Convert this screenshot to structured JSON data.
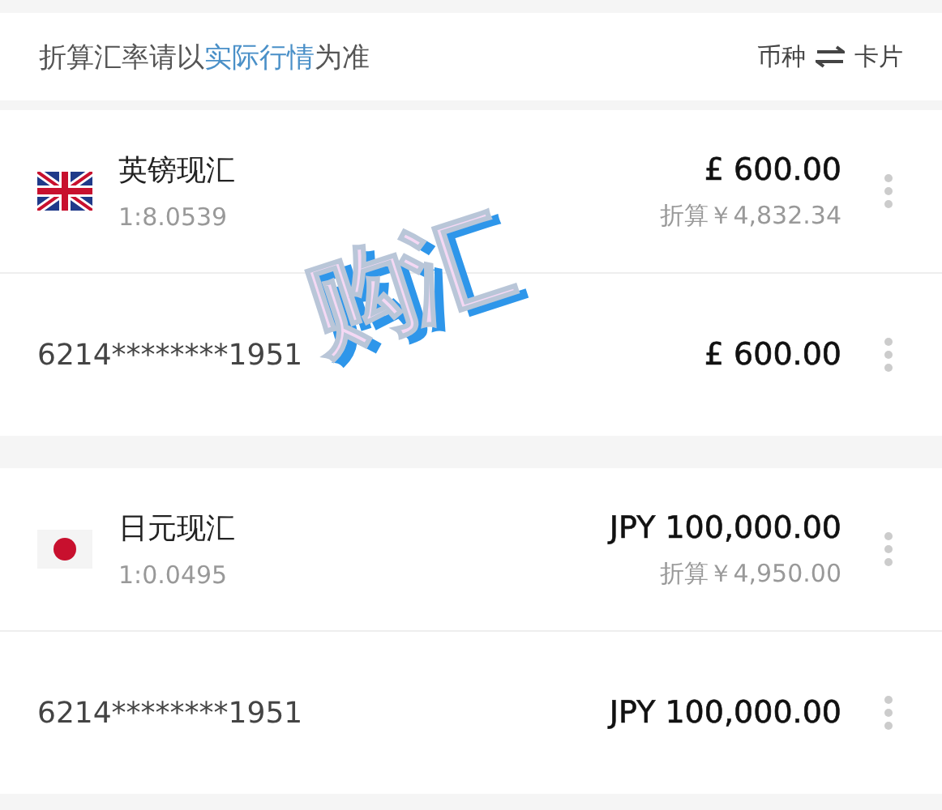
{
  "notice": {
    "before": "折算汇率请以",
    "link": "实际行情",
    "after": "为准"
  },
  "toggle": {
    "left": "币种",
    "right": "卡片"
  },
  "groups": [
    {
      "currency": {
        "kind": "gb",
        "name": "英镑现汇",
        "rate": "1:8.0539",
        "amount": "£ 600.00",
        "converted": "折算￥4,832.34"
      },
      "card": {
        "number": "6214********1951",
        "amount": "£ 600.00"
      }
    },
    {
      "currency": {
        "kind": "jp",
        "name": "日元现汇",
        "rate": "1:0.0495",
        "amount": "JPY 100,000.00",
        "converted": "折算￥4,950.00"
      },
      "card": {
        "number": "6214********1951",
        "amount": "JPY 100,000.00"
      }
    }
  ],
  "sticker": {
    "text": "购汇"
  }
}
